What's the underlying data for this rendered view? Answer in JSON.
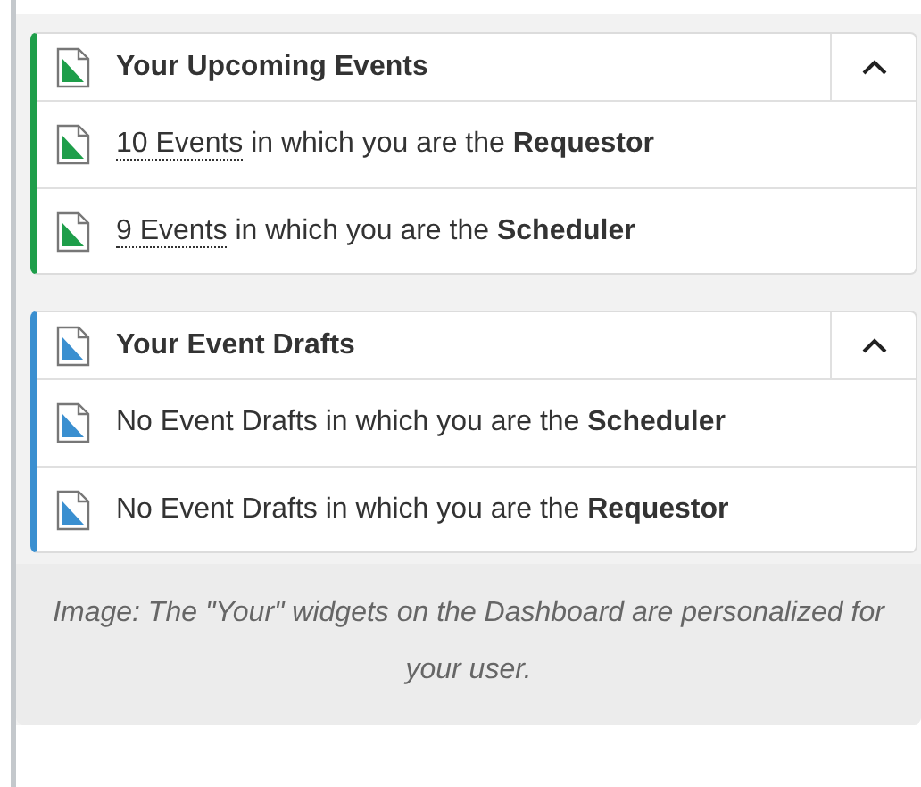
{
  "widgets": [
    {
      "title": "Your Upcoming Events",
      "color": "#1e9e4a",
      "expanded": true,
      "items": [
        {
          "link": "10 Events",
          "text": " in which you are the **Requestor**"
        },
        {
          "link": "9 Events",
          "text": " in which you are the **Scheduler**"
        }
      ]
    },
    {
      "title": "Your Event Drafts",
      "color": "#3a8fd0",
      "expanded": true,
      "items": [
        {
          "text": "No Event Drafts in which you are the **Scheduler**"
        },
        {
          "text": "No Event Drafts in which you are the **Requestor**"
        }
      ]
    }
  ],
  "caption": "Image: The \"Your\" widgets on the Dashboard are personalized for your user."
}
